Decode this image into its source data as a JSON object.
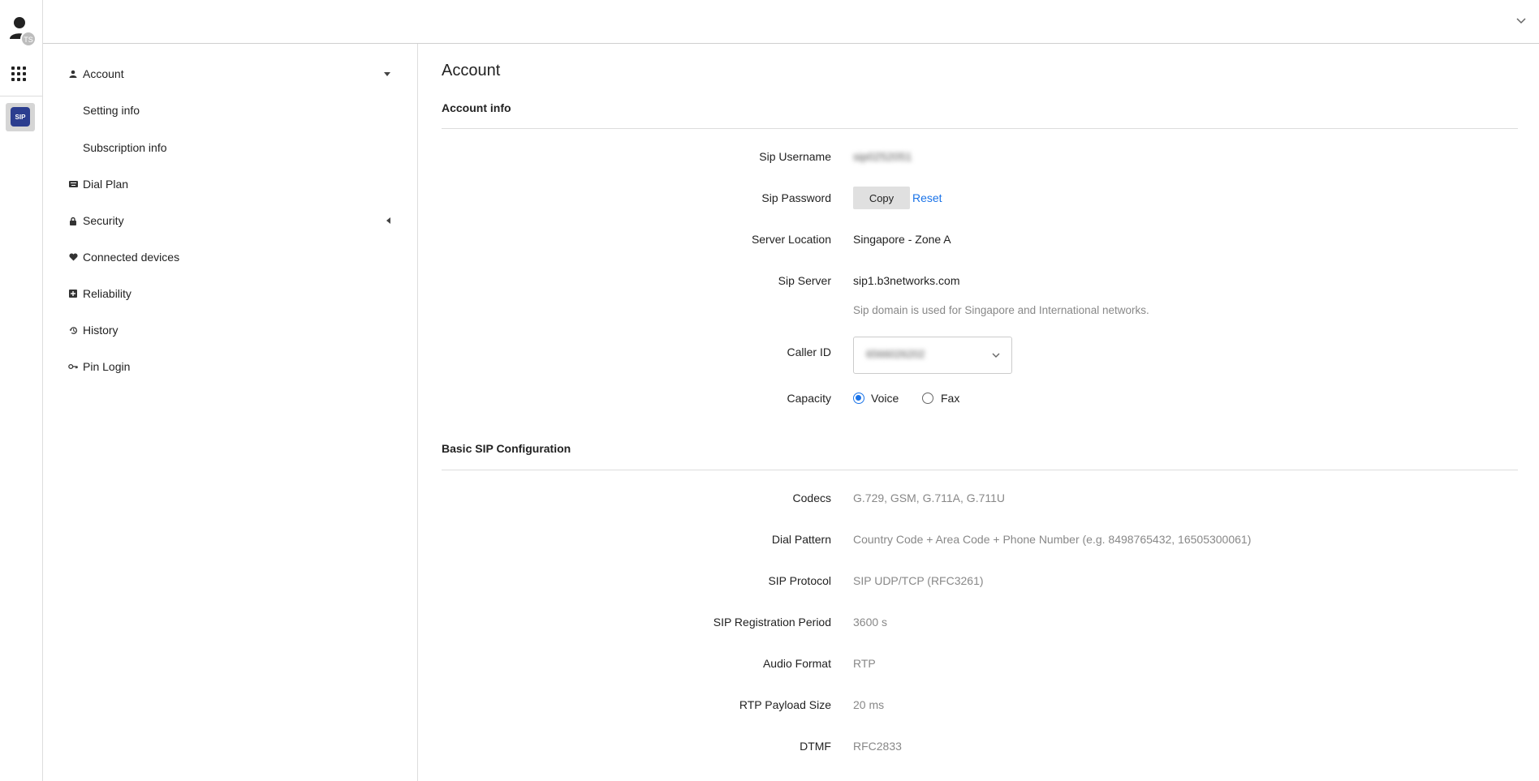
{
  "rail": {
    "avatar_initials": "TS",
    "sip_tile_text": "SIP"
  },
  "sidebar": {
    "items": [
      {
        "label": "Account",
        "icon": "person-icon"
      },
      {
        "label": "Setting info"
      },
      {
        "label": "Subscription info"
      },
      {
        "label": "Dial Plan",
        "icon": "keyboard-icon"
      },
      {
        "label": "Security",
        "icon": "lock-icon"
      },
      {
        "label": "Connected devices",
        "icon": "heart-icon"
      },
      {
        "label": "Reliability",
        "icon": "plus-box-icon"
      },
      {
        "label": "History",
        "icon": "history-icon"
      },
      {
        "label": "Pin Login",
        "icon": "key-icon"
      }
    ]
  },
  "main": {
    "title": "Account",
    "account_info": {
      "heading": "Account info",
      "sip_username_label": "Sip Username",
      "sip_username_value": "sip0252051",
      "sip_password_label": "Sip Password",
      "copy_label": "Copy",
      "reset_label": "Reset",
      "server_location_label": "Server Location",
      "server_location_value": "Singapore - Zone A",
      "sip_server_label": "Sip Server",
      "sip_server_value": "sip1.b3networks.com",
      "sip_server_hint": "Sip domain is used for Singapore and International networks.",
      "caller_id_label": "Caller ID",
      "caller_id_value": "6566026202",
      "capacity_label": "Capacity",
      "capacity_options": [
        "Voice",
        "Fax"
      ],
      "capacity_selected": "Voice"
    },
    "basic_sip": {
      "heading": "Basic SIP Configuration",
      "rows": [
        {
          "label": "Codecs",
          "value": "G.729, GSM, G.711A, G.711U"
        },
        {
          "label": "Dial Pattern",
          "value": "Country Code + Area Code + Phone Number (e.g. 8498765432, 16505300061)"
        },
        {
          "label": "SIP Protocol",
          "value": "SIP UDP/TCP (RFC3261)"
        },
        {
          "label": "SIP Registration Period",
          "value": "3600 s"
        },
        {
          "label": "Audio Format",
          "value": "RTP"
        },
        {
          "label": "RTP Payload Size",
          "value": "20 ms"
        },
        {
          "label": "DTMF",
          "value": "RFC2833"
        }
      ]
    }
  },
  "colors": {
    "accent": "#1a73e8",
    "sip_brand": "#2b3d8f"
  }
}
